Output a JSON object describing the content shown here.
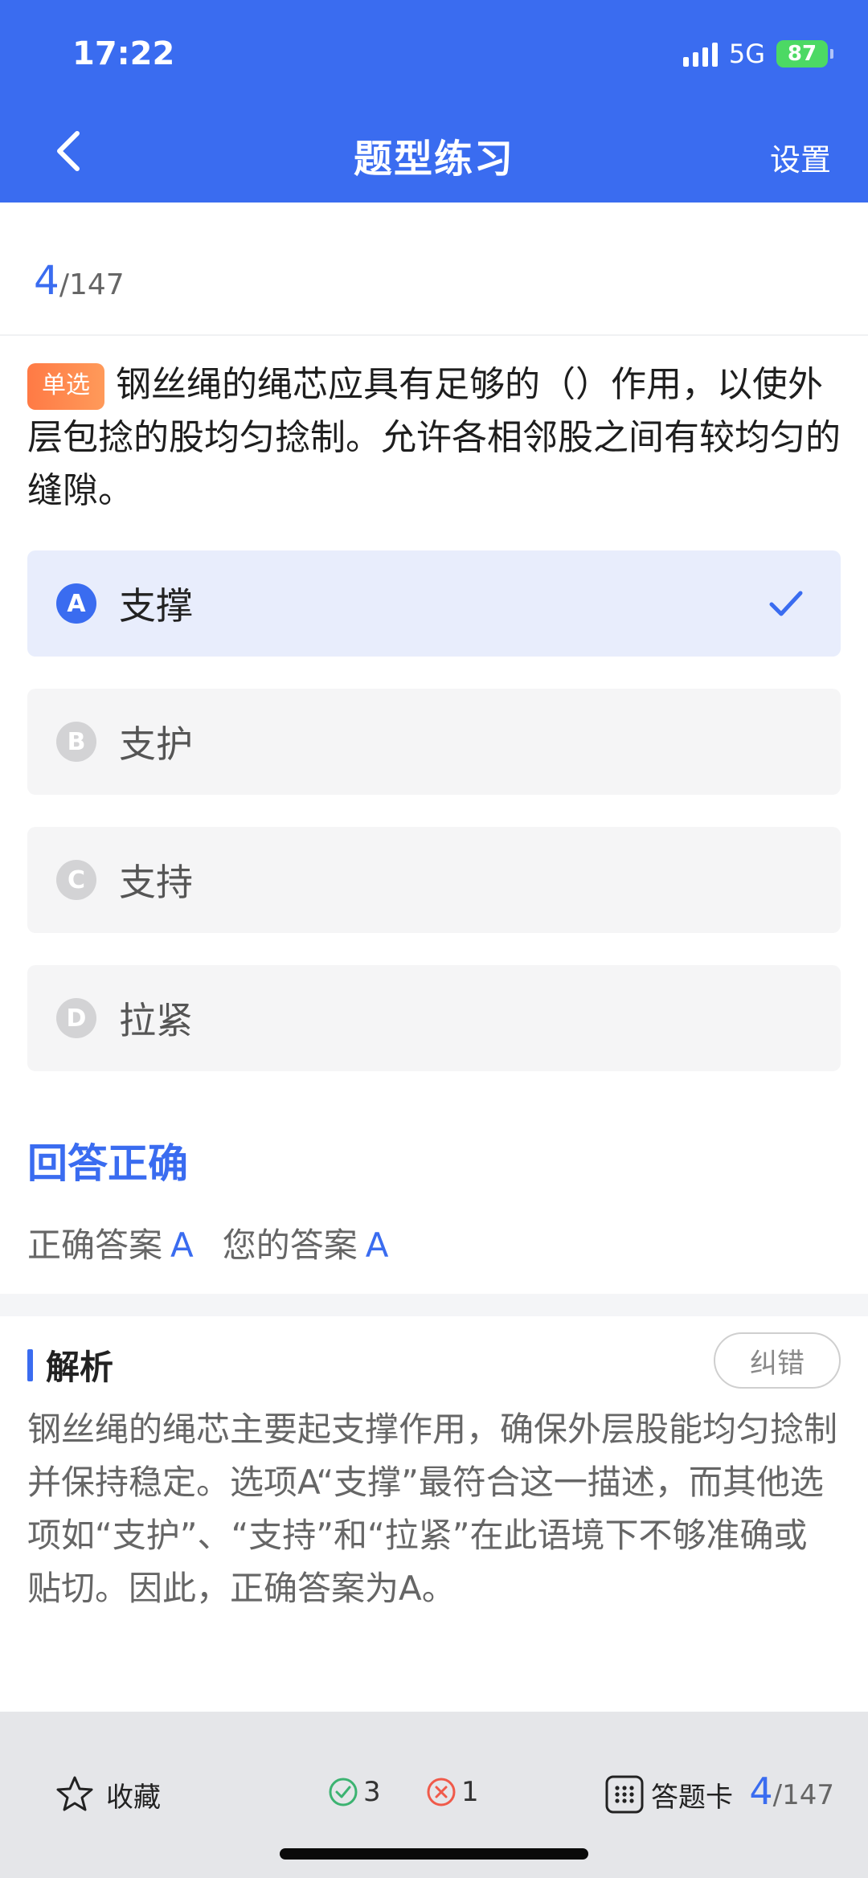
{
  "status_bar": {
    "time": "17:22",
    "network": "5G",
    "battery": "87"
  },
  "header": {
    "title": "题型练习",
    "settings_label": "设置"
  },
  "progress": {
    "current": "4",
    "total": "/147"
  },
  "question": {
    "type_tag": "单选",
    "text": "钢丝绳的绳芯应具有足够的（）作用，以使外层包捻的股均匀捻制。允许各相邻股之间有较均匀的缝隙。"
  },
  "options": [
    {
      "letter": "A",
      "text": "支撑",
      "selected": true
    },
    {
      "letter": "B",
      "text": "支护",
      "selected": false
    },
    {
      "letter": "C",
      "text": "支持",
      "selected": false
    },
    {
      "letter": "D",
      "text": "拉紧",
      "selected": false
    }
  ],
  "result": {
    "title": "回答正确",
    "correct_label": "正确答案",
    "correct_value": "A",
    "your_label": "您的答案",
    "your_value": "A"
  },
  "analysis": {
    "label": "解析",
    "report_label": "纠错",
    "text": "钢丝绳的绳芯主要起支撑作用，确保外层股能均匀捻制并保持稳定。选项A“支撑”最符合这一描述，而其他选项如“支护”、“支持”和“拉紧”在此语境下不够准确或贴切。因此，正确答案为A。"
  },
  "bottom_bar": {
    "favorite_label": "收藏",
    "correct_count": "3",
    "wrong_count": "1",
    "answer_card_label": "答题卡",
    "current": "4",
    "total": "/147"
  },
  "colors": {
    "primary": "#3a6cf0",
    "tag": "#ff7a45",
    "ok": "#3cb371",
    "err": "#f05a4a"
  }
}
